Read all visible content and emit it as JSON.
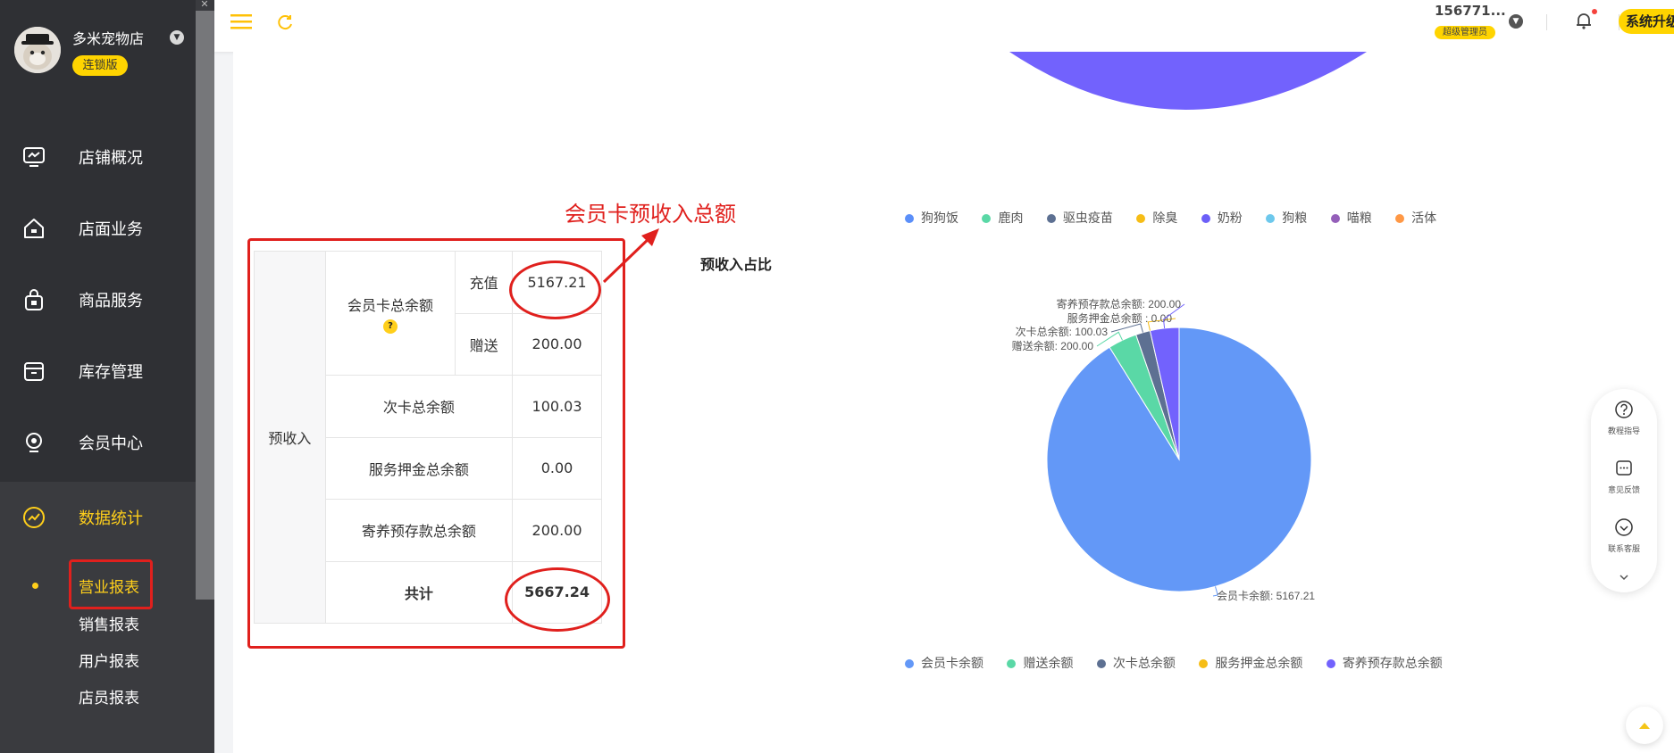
{
  "store": {
    "name": "多米宠物店",
    "badge": "连锁版"
  },
  "sidebar": {
    "items": [
      {
        "label": "店铺概况",
        "icon": "monitor-icon"
      },
      {
        "label": "店面业务",
        "icon": "house-icon"
      },
      {
        "label": "商品服务",
        "icon": "bag-icon"
      },
      {
        "label": "库存管理",
        "icon": "box-icon"
      },
      {
        "label": "会员中心",
        "icon": "member-icon"
      },
      {
        "label": "数据统计",
        "icon": "trend-icon"
      }
    ],
    "subitems": [
      "营业报表",
      "销售报表",
      "用户报表",
      "店员报表"
    ]
  },
  "topbar": {
    "user": "156771...",
    "role": "超级管理员",
    "upgrade": "系统升级"
  },
  "annotation": {
    "label": "会员卡预收入总额"
  },
  "table": {
    "prefix": "预收入",
    "card_label": "会员卡总余额",
    "help": "?",
    "recharge_label": "充值",
    "recharge_value": "5167.21",
    "gift_label": "赠送",
    "gift_value": "200.00",
    "rows": [
      {
        "label": "次卡总余额",
        "value": "100.03"
      },
      {
        "label": "服务押金总余额",
        "value": "0.00"
      },
      {
        "label": "寄养预存款总余额",
        "value": "200.00"
      }
    ],
    "total_label": "共计",
    "total_value": "5667.24"
  },
  "legend_top": [
    {
      "label": "狗狗饭",
      "color": "#5b8ff9"
    },
    {
      "label": "鹿肉",
      "color": "#5ad8a6"
    },
    {
      "label": "驱虫疫苗",
      "color": "#5d7092"
    },
    {
      "label": "除臭",
      "color": "#f6bd16"
    },
    {
      "label": "奶粉",
      "color": "#6c5ff8"
    },
    {
      "label": "狗粮",
      "color": "#6dc8ec"
    },
    {
      "label": "喵粮",
      "color": "#945fb9"
    },
    {
      "label": "活体",
      "color": "#ff9845"
    }
  ],
  "chart_data": {
    "type": "pie",
    "title": "预收入占比",
    "slices": [
      {
        "name": "会员卡余额",
        "value": 5167.21,
        "color": "#6398f7"
      },
      {
        "name": "赠送余额",
        "value": 200.0,
        "color": "#5ad8a6"
      },
      {
        "name": "次卡总余额",
        "value": 100.03,
        "color": "#5d7092"
      },
      {
        "name": "服务押金总余额",
        "value": 0.0,
        "color": "#f6bd16"
      },
      {
        "name": "寄养预存款总余额",
        "value": 200.0,
        "color": "#7262fd"
      }
    ],
    "labels": [
      "会员卡余额: 5167.21",
      "赠送余额: 200.00",
      "次卡总余额: 100.03",
      "服务押金总余额 : 0.00",
      "寄养预存款总余额: 200.00"
    ],
    "legend_position": "bottom"
  },
  "float_panel": [
    {
      "label": "教程指导",
      "icon": "question-icon"
    },
    {
      "label": "意见反馈",
      "icon": "feedback-icon"
    },
    {
      "label": "联系客服",
      "icon": "service-icon"
    }
  ]
}
